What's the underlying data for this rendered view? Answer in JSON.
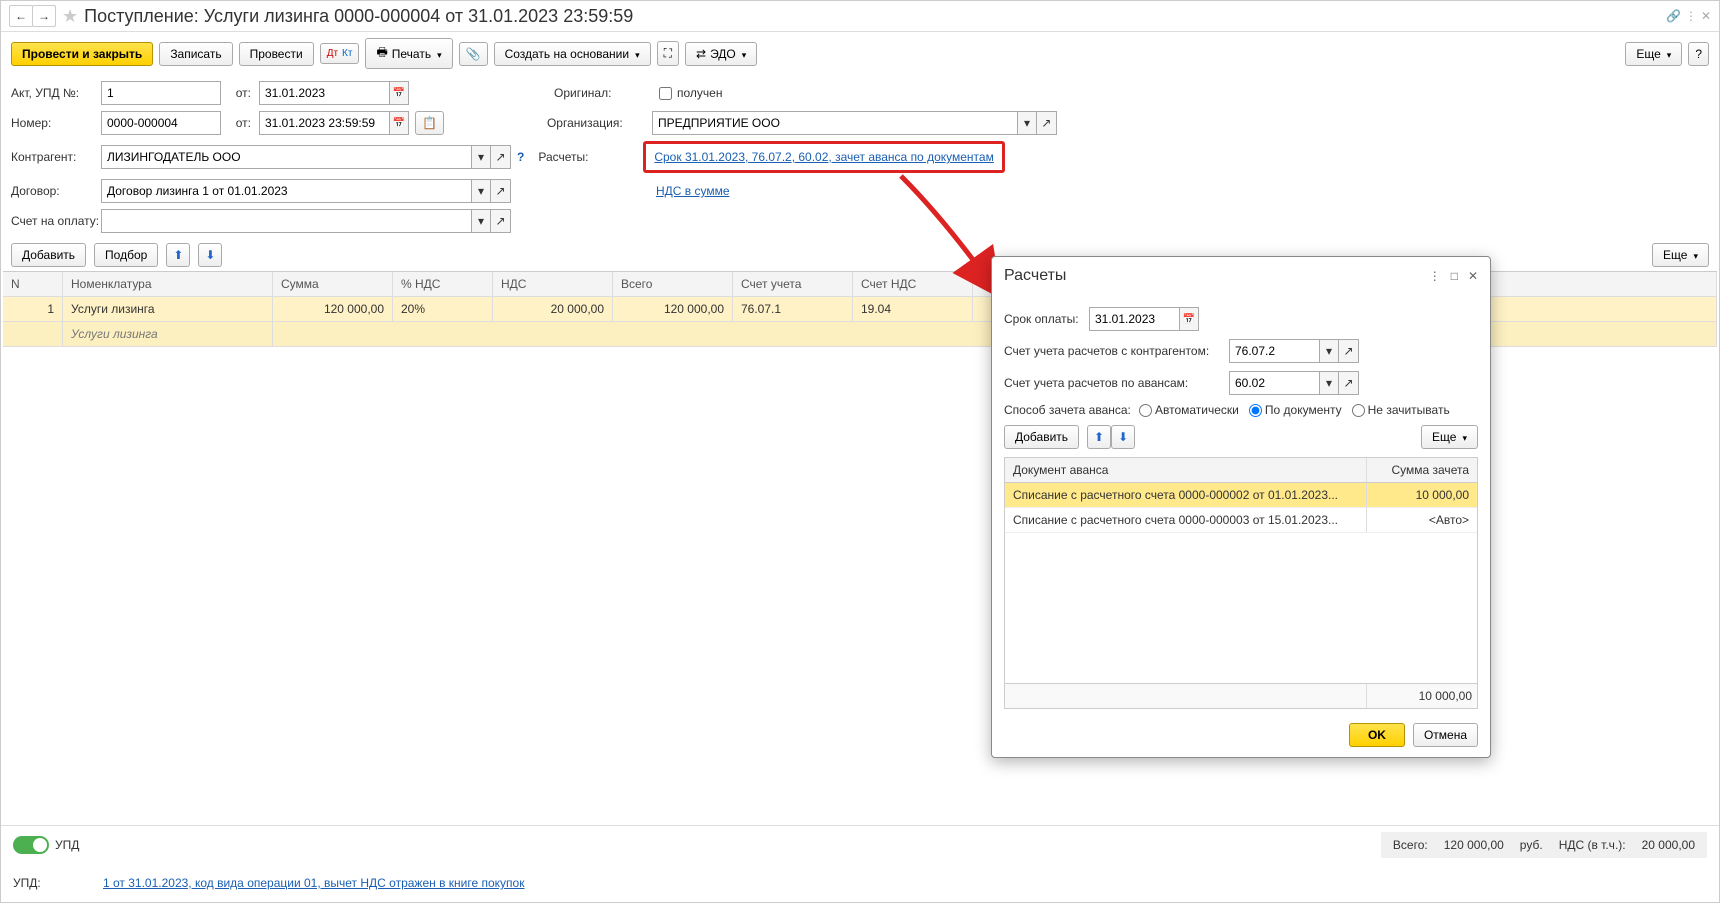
{
  "header": {
    "title": "Поступление: Услуги лизинга 0000-000004 от 31.01.2023 23:59:59"
  },
  "toolbar": {
    "post_close": "Провести и закрыть",
    "save": "Записать",
    "post": "Провести",
    "print": "Печать",
    "create_based": "Создать на основании",
    "edo": "ЭДО",
    "more": "Еще"
  },
  "form": {
    "akt_label": "Акт, УПД №:",
    "akt_no": "1",
    "from1": "от:",
    "akt_date": "31.01.2023",
    "num_label": "Номер:",
    "num": "0000-000004",
    "from2": "от:",
    "num_date": "31.01.2023 23:59:59",
    "original_label": "Оригинал:",
    "received": "получен",
    "org_label": "Организация:",
    "org": "ПРЕДПРИЯТИЕ ООО",
    "counter_label": "Контрагент:",
    "counter": "ЛИЗИНГОДАТЕЛЬ ООО",
    "calc_label": "Расчеты:",
    "calc_link": "Срок 31.01.2023, 76.07.2, 60.02, зачет аванса по документам",
    "contract_label": "Договор:",
    "contract": "Договор лизинга 1 от 01.01.2023",
    "nds_link": "НДС в сумме",
    "invoice_label": "Счет на оплату:"
  },
  "tablebar": {
    "add": "Добавить",
    "pick": "Подбор",
    "more": "Еще"
  },
  "table": {
    "h": {
      "n": "N",
      "nom": "Номенклатура",
      "sum": "Сумма",
      "ndsrate": "% НДС",
      "nds": "НДС",
      "total": "Всего",
      "acc": "Счет учета",
      "ndsacc": "Счет НДС"
    },
    "r1": {
      "n": "1",
      "nom": "Услуги лизинга",
      "sum": "120 000,00",
      "ndsrate": "20%",
      "nds": "20 000,00",
      "total": "120 000,00",
      "acc": "76.07.1",
      "ndsacc": "19.04",
      "sub": "Услуги лизинга"
    }
  },
  "footer": {
    "upd_toggle": "УПД",
    "total_lbl": "Всего:",
    "total_val": "120 000,00",
    "cur": "руб.",
    "nds_lbl": "НДС (в т.ч.):",
    "nds_val": "20 000,00",
    "upd2": "УПД:",
    "upd_link": "1 от 31.01.2023, код вида операции 01, вычет НДС отражен в книге покупок"
  },
  "popup": {
    "title": "Расчеты",
    "due_lbl": "Срок оплаты:",
    "due": "31.01.2023",
    "acc1_lbl": "Счет учета расчетов с контрагентом:",
    "acc1": "76.07.2",
    "acc2_lbl": "Счет учета расчетов по авансам:",
    "acc2": "60.02",
    "method_lbl": "Способ зачета аванса:",
    "m_auto": "Автоматически",
    "m_doc": "По документу",
    "m_none": "Не зачитывать",
    "add": "Добавить",
    "more": "Еще",
    "th1": "Документ аванса",
    "th2": "Сумма зачета",
    "r1": {
      "doc": "Списание с расчетного счета 0000-000002 от 01.01.2023...",
      "sum": "10 000,00"
    },
    "r2": {
      "doc": "Списание с расчетного счета 0000-000003 от 15.01.2023...",
      "sum": "<Авто>"
    },
    "foot_sum": "10 000,00",
    "ok": "OK",
    "cancel": "Отмена"
  }
}
